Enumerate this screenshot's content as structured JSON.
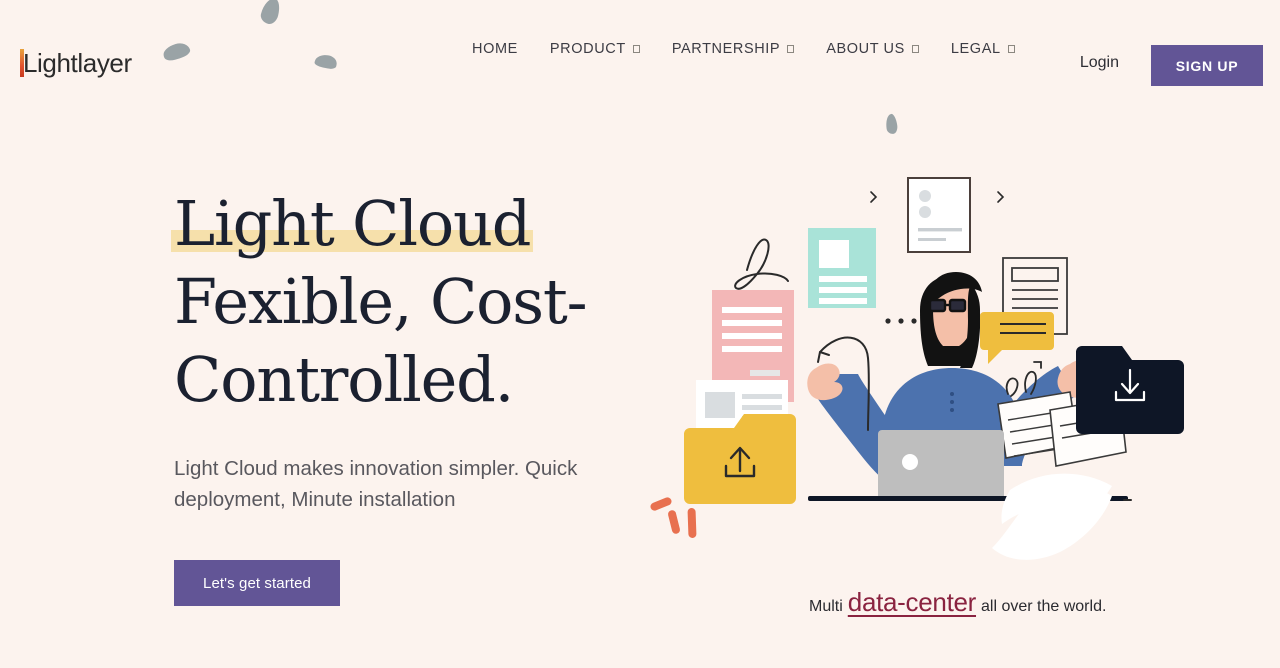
{
  "theme": {
    "background": "#FCF3EE",
    "accent_purple": "#625596",
    "highlight_yellow": "#F6E0AB",
    "headline_color": "#1b2130",
    "link_maroon": "#8a2340"
  },
  "header": {
    "logo": {
      "text": "Lightlayer",
      "accent_bar_colors": [
        "#e8a33d",
        "#e2522e",
        "#c73a1f"
      ]
    },
    "nav": [
      {
        "label": "HOME",
        "has_dropdown": false
      },
      {
        "label": "PRODUCT",
        "has_dropdown": true
      },
      {
        "label": "PARTNERSHIP",
        "has_dropdown": true
      },
      {
        "label": "ABOUT US",
        "has_dropdown": true
      },
      {
        "label": "LEGAL",
        "has_dropdown": true
      }
    ],
    "login_label": "Login",
    "signup_label": "SIGN UP"
  },
  "hero": {
    "headline_line1_highlight": "Light Cloud",
    "headline_line2": "Fexible, Cost-",
    "headline_line3": "Controlled.",
    "subtitle": "Light Cloud makes innovation simpler. Quick deployment, Minute installation",
    "cta_label": "Let's get started"
  },
  "caption": {
    "prefix": "Multi",
    "emphasis": "data-center",
    "suffix": "all over the world."
  },
  "illustration": {
    "alt": "Person at laptop surrounded by documents and folders",
    "elements": [
      "pink-document",
      "mint-document",
      "white-card-with-dots",
      "outlined-document",
      "stacked-papers",
      "yellow-folder-upload",
      "navy-folder-download",
      "yellow-speech-bubble",
      "gray-laptop",
      "person-with-glasses",
      "white-wavy-paper",
      "coral-tick-marks"
    ]
  }
}
